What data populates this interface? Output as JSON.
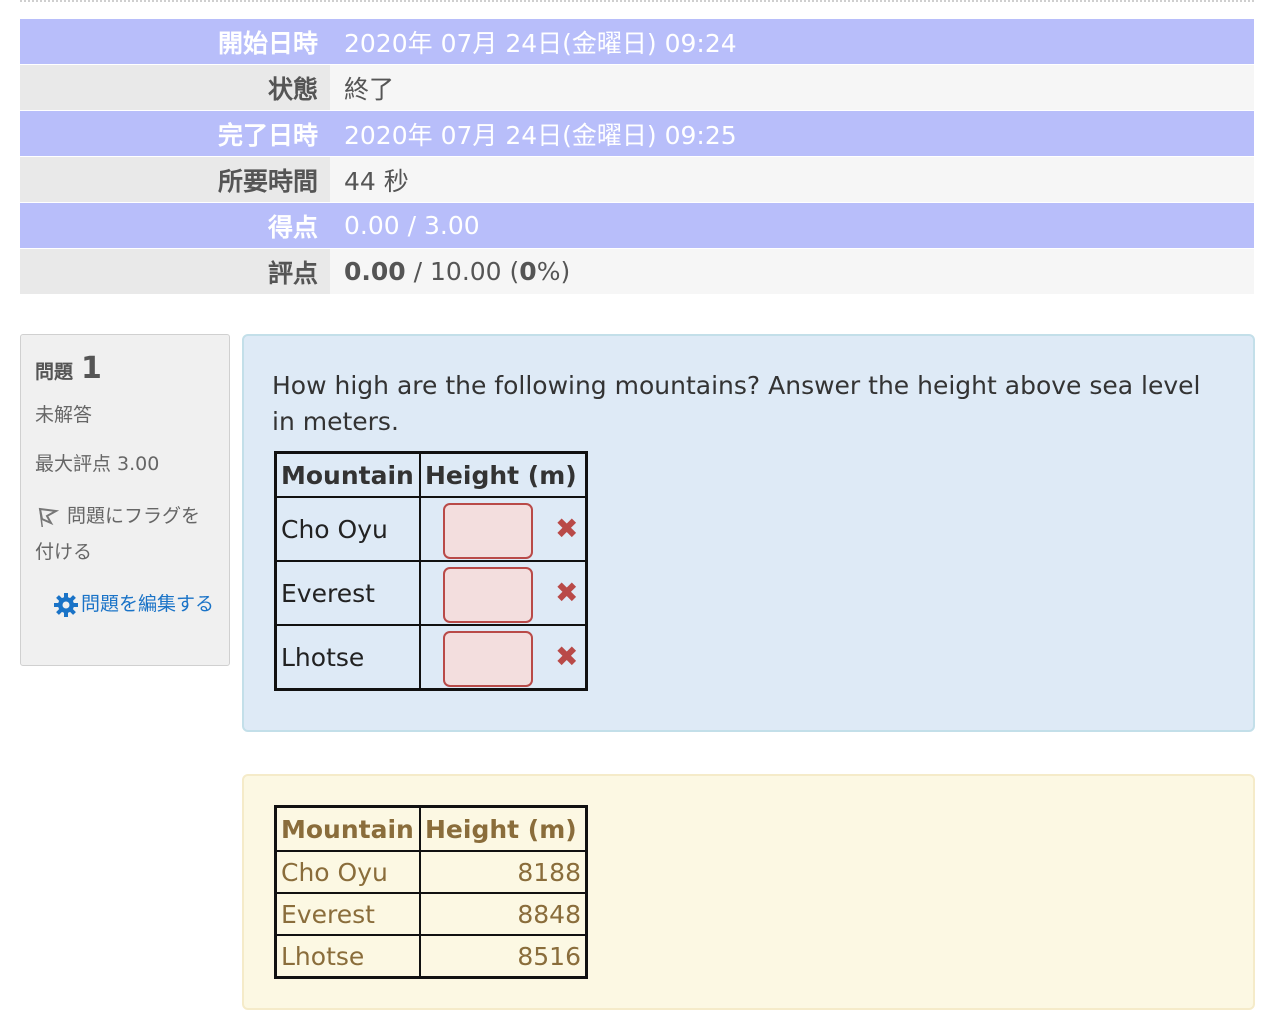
{
  "summary": [
    {
      "label": "開始日時",
      "value": "2020年 07月 24日(金曜日) 09:24"
    },
    {
      "label": "状態",
      "value": "終了"
    },
    {
      "label": "完了日時",
      "value": "2020年 07月 24日(金曜日) 09:25"
    },
    {
      "label": "所要時間",
      "value": "44 秒"
    },
    {
      "label": "得点",
      "value": "0.00 / 3.00"
    },
    {
      "label": "評点",
      "grade": "0.00",
      "grade_sep": " / 10.00 (",
      "pct": "0",
      "pct_tail": "%)"
    }
  ],
  "question_info": {
    "label": "問題",
    "number": "1",
    "status": "未解答",
    "max_mark": "最大評点 3.00",
    "flag_label": "問題にフラグを付ける",
    "edit_label": "問題を編集する",
    "flag_icon": "flag-icon",
    "edit_icon": "gear-icon"
  },
  "question": {
    "text": "How high are the following mountains? Answer the height above sea level in meters.",
    "col_mountain": "Mountain",
    "col_height": "Height (m)",
    "rows": [
      {
        "name": "Cho Oyu",
        "answer": "",
        "mark": "✖"
      },
      {
        "name": "Everest",
        "answer": "",
        "mark": "✖"
      },
      {
        "name": "Lhotse",
        "answer": "",
        "mark": "✖"
      }
    ]
  },
  "answer": {
    "col_mountain": "Mountain",
    "col_height": "Height (m)",
    "rows": [
      {
        "name": "Cho Oyu",
        "height": "8188"
      },
      {
        "name": "Everest",
        "height": "8848"
      },
      {
        "name": "Lhotse",
        "height": "8516"
      }
    ]
  },
  "colors": {
    "summary_highlight": "#b8befa",
    "incorrect": "#b94a48",
    "question_bg": "#deeaf6",
    "answer_bg": "#fcf8e3",
    "answer_text": "#8a6d3b",
    "link": "#1a73c7"
  }
}
